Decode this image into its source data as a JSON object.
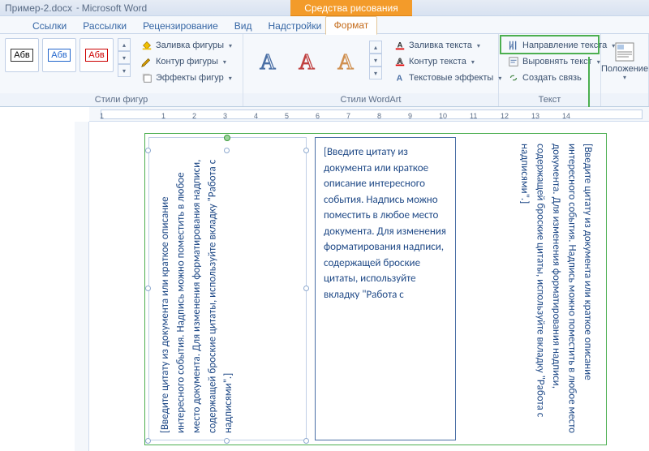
{
  "title": {
    "doc": "Пример-2.docx",
    "app": "Microsoft Word"
  },
  "contextTab": "Средства рисования",
  "tabs": {
    "links": "Ссылки",
    "mail": "Рассылки",
    "review": "Рецензирование",
    "view": "Вид",
    "addins": "Надстройки",
    "format": "Формат"
  },
  "ribbon": {
    "styleSwatch": "Абв",
    "shapeFill": "Заливка фигуры",
    "shapeOutline": "Контур фигуры",
    "shapeEffects": "Эффекты фигур",
    "textFill": "Заливка текста",
    "textOutline": "Контур текста",
    "textEffects": "Текстовые эффекты",
    "textDirection": "Направление текста",
    "alignText": "Выровнять текст",
    "createLink": "Создать связь",
    "position": "Положение",
    "groupShapes": "Стили фигур",
    "groupWordArt": "Стили WordArt",
    "groupText": "Текст"
  },
  "ruler": [
    "1",
    "",
    "1",
    "2",
    "3",
    "4",
    "5",
    "6",
    "7",
    "8",
    "9",
    "10",
    "11",
    "12",
    "13",
    "14"
  ],
  "placeholder": "[Введите цитату из документа или краткое описание интересного события. Надпись можно поместить в любое место документа. Для изменения форматирования надписи, содержащей броские цитаты, используйте вкладку \"Работа с надписями\".]",
  "placeholderBox2": "[Введите цитату из документа или краткое описание интересного события. Надпись можно поместить в любое место документа. Для изменения форматирования надписи, содержащей броские цитаты, используйте вкладку \"Работа с"
}
